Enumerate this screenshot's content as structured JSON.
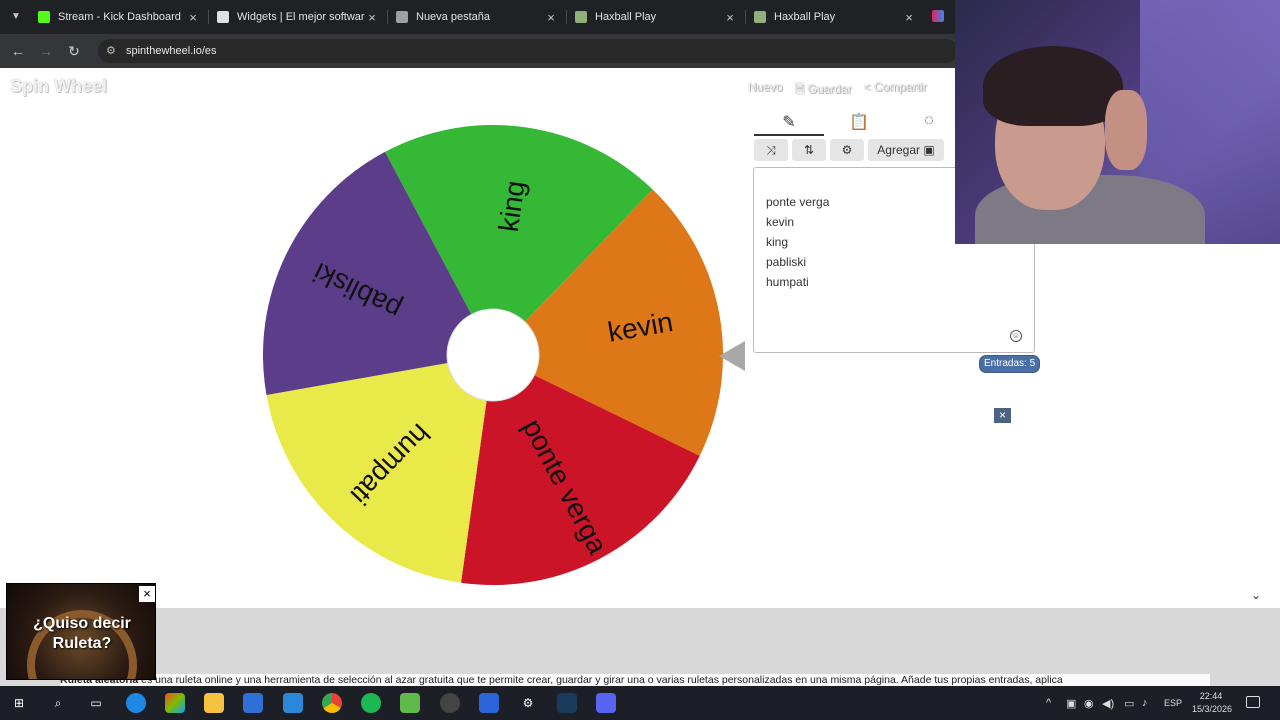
{
  "tabs": [
    {
      "title": "Stream - Kick Dashboard",
      "favicon_color": "#53fc18"
    },
    {
      "title": "Widgets | El mejor software p",
      "favicon_color": "#e0e0e0"
    },
    {
      "title": "Nueva pestaña",
      "favicon_color": "#9aa0a6"
    },
    {
      "title": "Haxball Play",
      "favicon_color": "#8fb07a"
    },
    {
      "title": "Haxball Play",
      "favicon_color": "#8fb07a"
    }
  ],
  "address": {
    "url": "spinthewheel.io/es"
  },
  "site": {
    "logo": "Spin Wheel",
    "actions": {
      "new": "Nuevo",
      "save": "Guardar",
      "share": "Compartir"
    }
  },
  "wheel": {
    "colors": [
      "#35b836",
      "#de7718",
      "#cc1428",
      "#e9e94a",
      "#5b3d8a"
    ],
    "segments": [
      "king",
      "kevin",
      "ponte verga",
      "humpati",
      "pabliski"
    ]
  },
  "editor": {
    "add_label": "Agregar",
    "entries": [
      "ponte verga",
      "kevin",
      "king",
      "pabliski",
      "humpati"
    ],
    "count_label": "Entradas: 5"
  },
  "popup": {
    "text_line1": "¿Quiso decir",
    "text_line2": "Ruleta?"
  },
  "description": {
    "bold": "Ruleta aleatoria",
    "text": " es una ruleta online y una herramienta de selección al azar gratuita que te permite crear, guardar y girar una o varias ruletas personalizadas en una misma página. Añade tus propias entradas, aplica"
  },
  "taskbar": {
    "language": "ESP",
    "time": "22:44",
    "date": "15/3/2026"
  }
}
